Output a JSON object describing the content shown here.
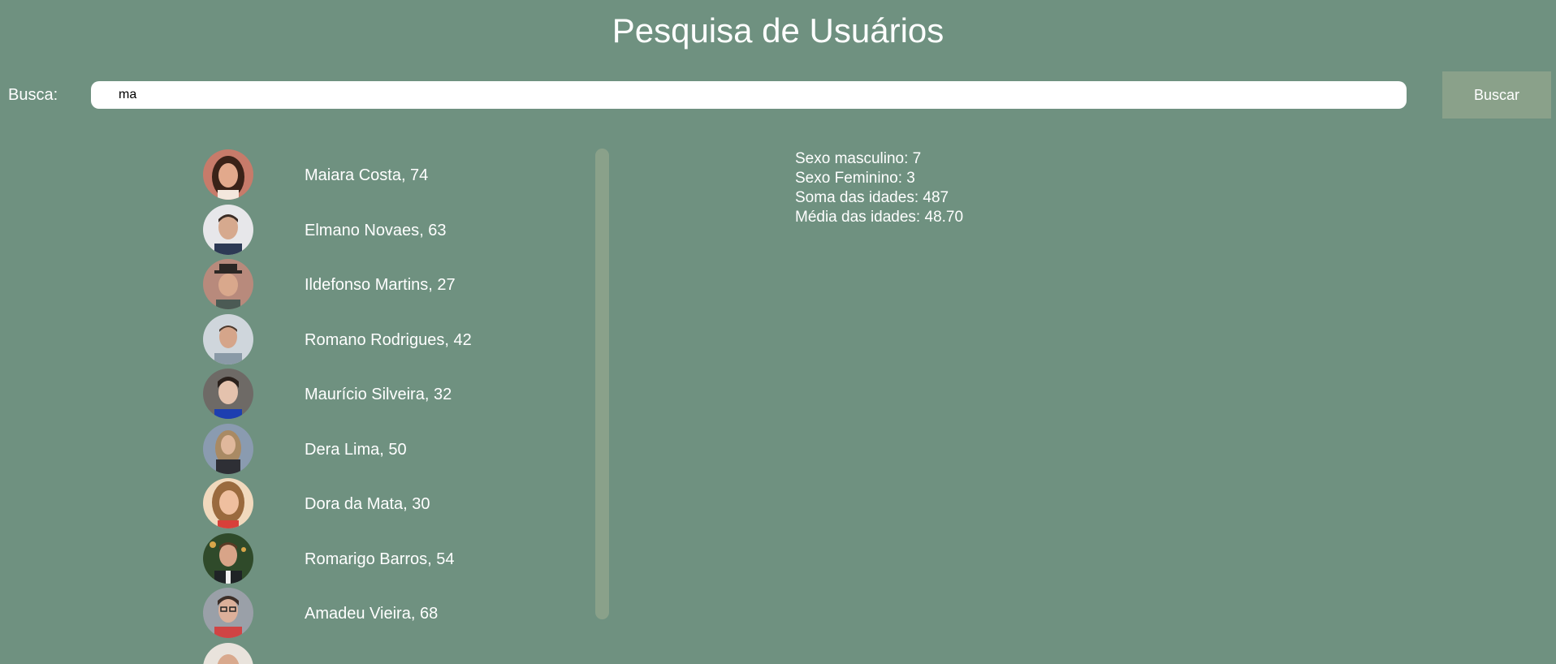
{
  "header": {
    "title": "Pesquisa de Usuários"
  },
  "search": {
    "label": "Busca:",
    "value": "ma",
    "button_label": "Buscar"
  },
  "users": [
    {
      "name": "Maiara Costa",
      "age": ", 74",
      "avatar": "woman-avatar"
    },
    {
      "name": "Elmano Novaes",
      "age": ", 63",
      "avatar": "man-avatar"
    },
    {
      "name": "Ildefonso Martins",
      "age": ", 27",
      "avatar": "man-with-hat-avatar"
    },
    {
      "name": "Romano Rodrigues",
      "age": ", 42",
      "avatar": "man-avatar"
    },
    {
      "name": "Maurício Silveira",
      "age": ", 32",
      "avatar": "man-avatar"
    },
    {
      "name": "Dera Lima",
      "age": ", 50",
      "avatar": "woman-avatar"
    },
    {
      "name": "Dora da Mata",
      "age": ", 30",
      "avatar": "woman-avatar"
    },
    {
      "name": "Romarigo Barros",
      "age": ", 54",
      "avatar": "man-avatar"
    },
    {
      "name": "Amadeu Vieira",
      "age": ", 68",
      "avatar": "man-avatar"
    }
  ],
  "stats": {
    "male_label": "Sexo masculino:",
    "male_value": " 7",
    "female_label": "Sexo Feminino:",
    "female_value": " 3",
    "sum_label": "Soma das idades:",
    "sum_value": " 487",
    "avg_label": "Média das idades:",
    "avg_value": " 48.70"
  },
  "colors": {
    "background": "#6f9180",
    "button": "#8aa18a",
    "text": "#ffffff"
  }
}
